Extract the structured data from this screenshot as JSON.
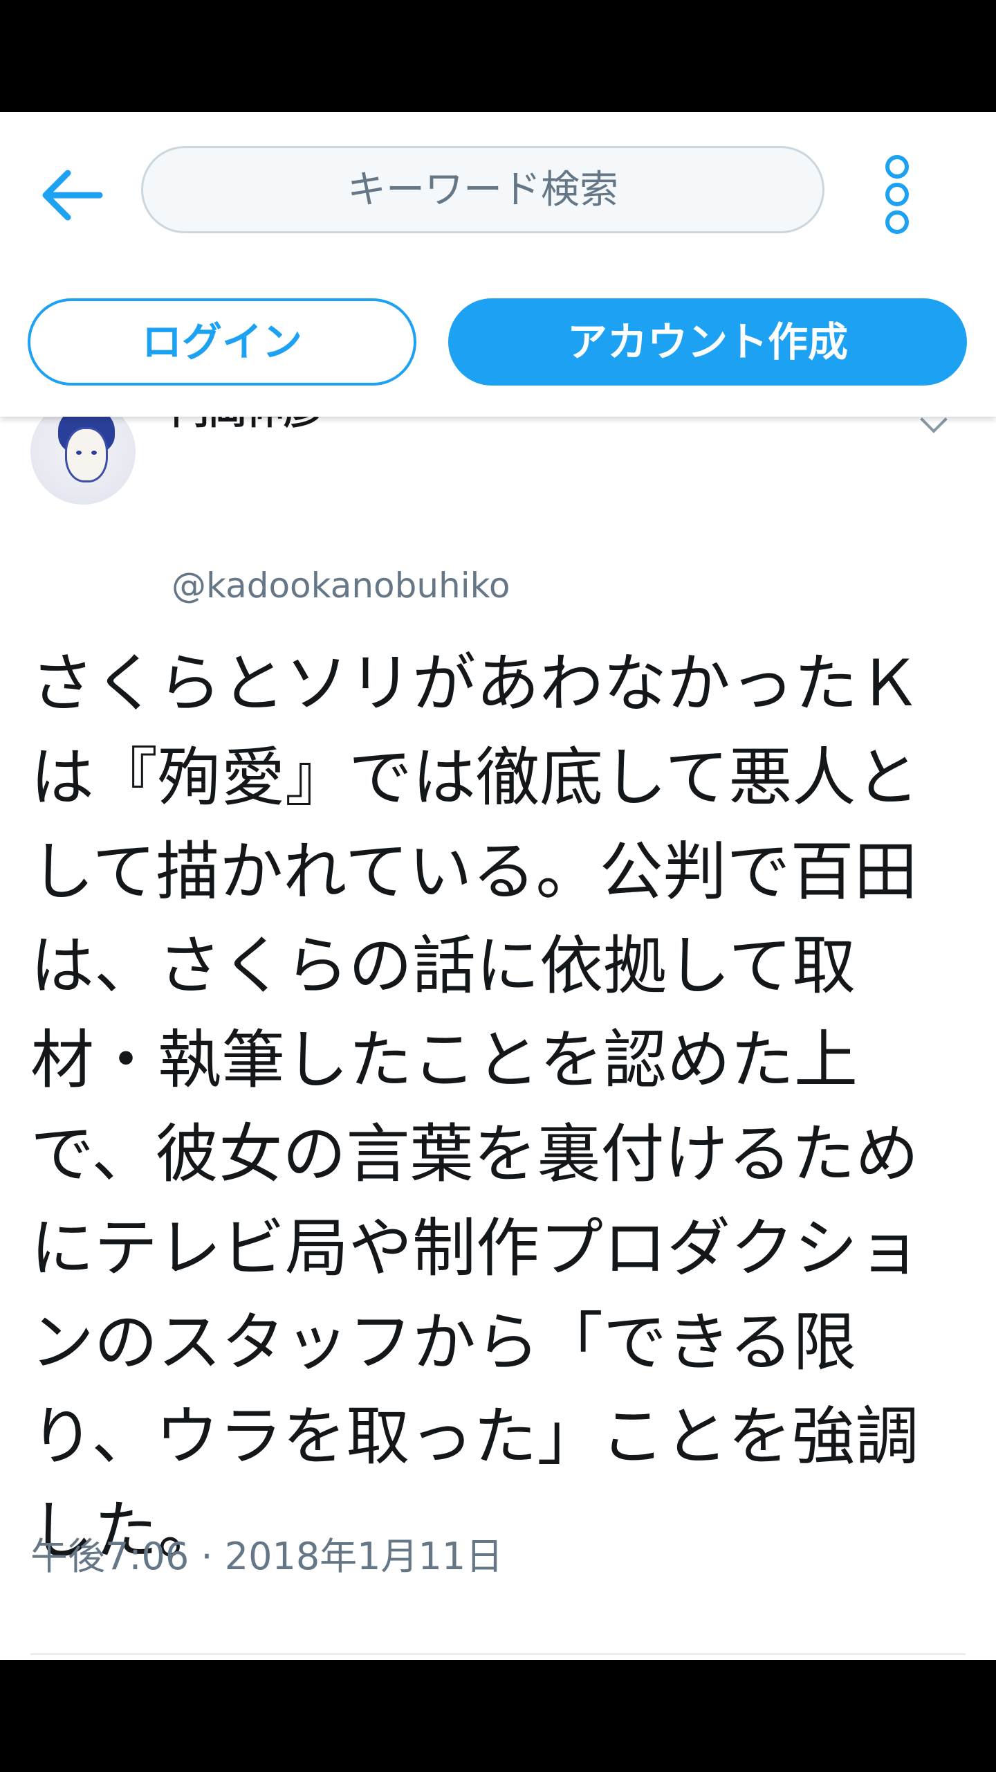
{
  "header": {
    "search_placeholder": "キーワード検索",
    "login_label": "ログイン",
    "signup_label": "アカウント作成",
    "back_icon": "arrow-left-icon",
    "more_icon": "more-vertical-icon",
    "accent_color": "#1da1f2"
  },
  "tweet": {
    "display_name": "門岡伸彦",
    "username": "@kadookanobuhiko",
    "text": "さくらとソリがあわなかったＫは『殉愛』では徹底して悪人として描かれている。公判で百田は、さくらの話に依拠して取材・執筆したことを認めた上で、彼女の言葉を裏付けるためにテレビ局や制作プロダクションのスタッフから「できる限り、ウラを取った」ことを強調した。",
    "timestamp": "午後7:06 · 2018年1月11日"
  }
}
